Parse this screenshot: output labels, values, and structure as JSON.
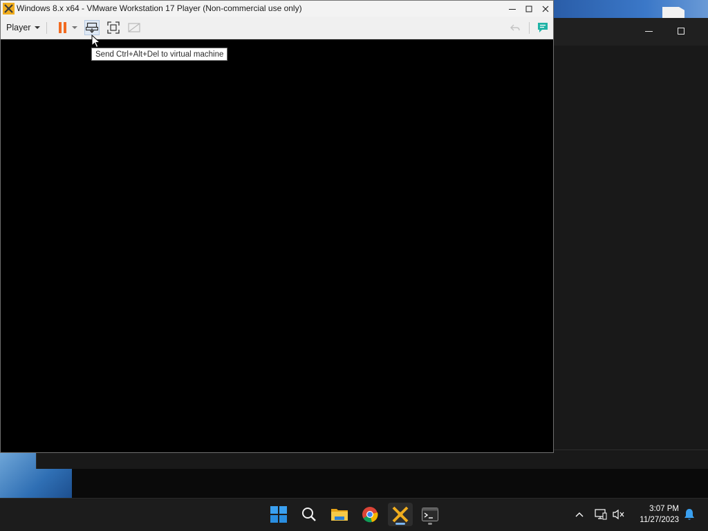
{
  "window": {
    "title": "Windows 8.x x64 - VMware Workstation 17 Player (Non-commercial use only)",
    "controls": [
      "minimize-icon",
      "maximize-icon",
      "close-icon"
    ]
  },
  "toolbar": {
    "player_label": "Player",
    "pause_color": "#f26b21",
    "message_color": "#1fb3a6"
  },
  "tooltip": {
    "text": "Send Ctrl+Alt+Del to virtual machine"
  },
  "taskbar": {
    "apps": [
      "windows-start-icon",
      "search-icon",
      "file-explorer-icon",
      "chrome-icon",
      "vmware-player-icon",
      "terminal-icon"
    ],
    "clock": {
      "time": "3:07 PM",
      "date": "11/27/2023"
    }
  }
}
